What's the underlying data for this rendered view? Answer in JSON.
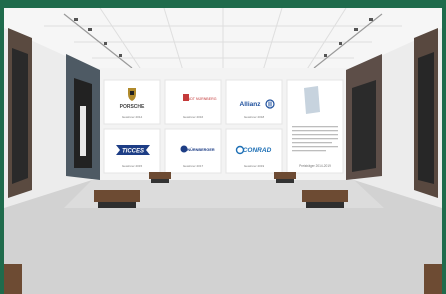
{
  "colors": {
    "frame_green": "#1f6b4c",
    "wall": "#f3f3f3",
    "ceiling": "#f7f7f7",
    "floor": "#cfcfcf",
    "bench": "#6d4b33"
  },
  "panels": {
    "logos": [
      {
        "name": "PORSCHE",
        "year": "Gewinner 2014",
        "icon": "porsche-crest-icon",
        "color": "#444444"
      },
      {
        "name": "STADT NÜRNBERG",
        "year": "Gewinner 2016",
        "icon": "nuernberg-crest-icon",
        "color": "#c43a3a"
      },
      {
        "name": "Allianz",
        "year": "Gewinner 2018",
        "icon": "allianz-eagle-icon",
        "color": "#1d4f9c"
      },
      {
        "name": "TICCES",
        "year": "Gewinner 2015",
        "icon": "ticces-ribbon-icon",
        "color": "#1d3d85"
      },
      {
        "name": "NÜRNBERGER",
        "year": "Gewinner 2017",
        "icon": "nuernberger-logo-icon",
        "color": "#1d3d85"
      },
      {
        "name": "CONRAD",
        "year": "Gewinner 2019",
        "icon": "conrad-logo-icon",
        "color": "#1d6fb5"
      }
    ],
    "right_caption": "Preisträger 2014-2019"
  }
}
